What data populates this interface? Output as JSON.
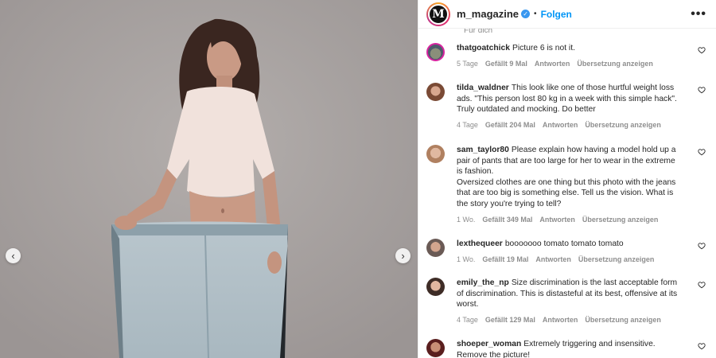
{
  "header": {
    "avatar_letter": "M",
    "username": "m_magazine",
    "verified_glyph": "✓",
    "separator": "•",
    "follow_label": "Folgen",
    "more_glyph": "•••"
  },
  "cutoff_text": "Für dich",
  "comments": [
    {
      "user": "thatgoatchick",
      "text": "Picture 6 is not it.",
      "time": "5 Tage",
      "likes": "Gefällt 9 Mal",
      "reply": "Antworten",
      "translate": "Übersetzung anzeigen"
    },
    {
      "user": "tilda_waldner",
      "text": "This look like one of those hurtful weight loss ads. \"This person lost 80 kg in a week with this simple hack\". Truly outdated and mocking. Do better",
      "time": "4 Tage",
      "likes": "Gefällt 204 Mal",
      "reply": "Antworten",
      "translate": "Übersetzung anzeigen"
    },
    {
      "user": "sam_taylor80",
      "text": "Please explain how having a model hold up a pair of pants that are too large for her to wear in the extreme is fashion.",
      "text2": "Oversized clothes are one thing but this photo with the jeans that are too big is something else. Tell us the vision. What is the story you're trying to tell?",
      "time": "1 Wo.",
      "likes": "Gefällt 349 Mal",
      "reply": "Antworten",
      "translate": "Übersetzung anzeigen"
    },
    {
      "user": "lexthequeer",
      "text": "booooooo tomato tomato tomato",
      "time": "1 Wo.",
      "likes": "Gefällt 19 Mal",
      "reply": "Antworten",
      "translate": "Übersetzung anzeigen"
    },
    {
      "user": "emily_the_np",
      "text": "Size discrimination is the last acceptable form of discrimination. This is distasteful at its best, offensive at its worst.",
      "time": "4 Tage",
      "likes": "Gefällt 129 Mal",
      "reply": "Antworten",
      "translate": "Übersetzung anzeigen"
    },
    {
      "user": "shoeper_woman",
      "text": "Extremely triggering and insensitive. Remove the picture!"
    }
  ],
  "nav": {
    "prev_glyph": "‹",
    "next_glyph": "›"
  }
}
